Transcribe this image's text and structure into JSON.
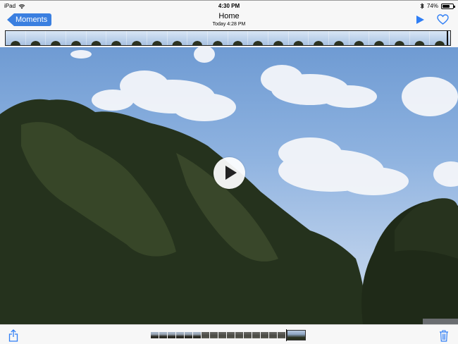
{
  "status_bar": {
    "device": "iPad",
    "time": "4:30 PM",
    "battery_percent": "74%",
    "battery_level": 0.74
  },
  "nav": {
    "back_label": "Moments",
    "title": "Home",
    "subtitle": "Today  4:28 PM"
  },
  "icons": {
    "wifi": "wifi-icon",
    "bluetooth": "bluetooth-icon",
    "battery": "battery-icon",
    "play": "play-icon",
    "favorite": "heart-icon",
    "share": "share-icon",
    "delete": "trash-icon"
  },
  "colors": {
    "accent": "#2f7ef5",
    "bar_background": "#f7f7f7"
  },
  "filmstrip": {
    "frame_count": 22,
    "position": 0.99
  },
  "mini_scrubber": {
    "frame_count": 16
  }
}
